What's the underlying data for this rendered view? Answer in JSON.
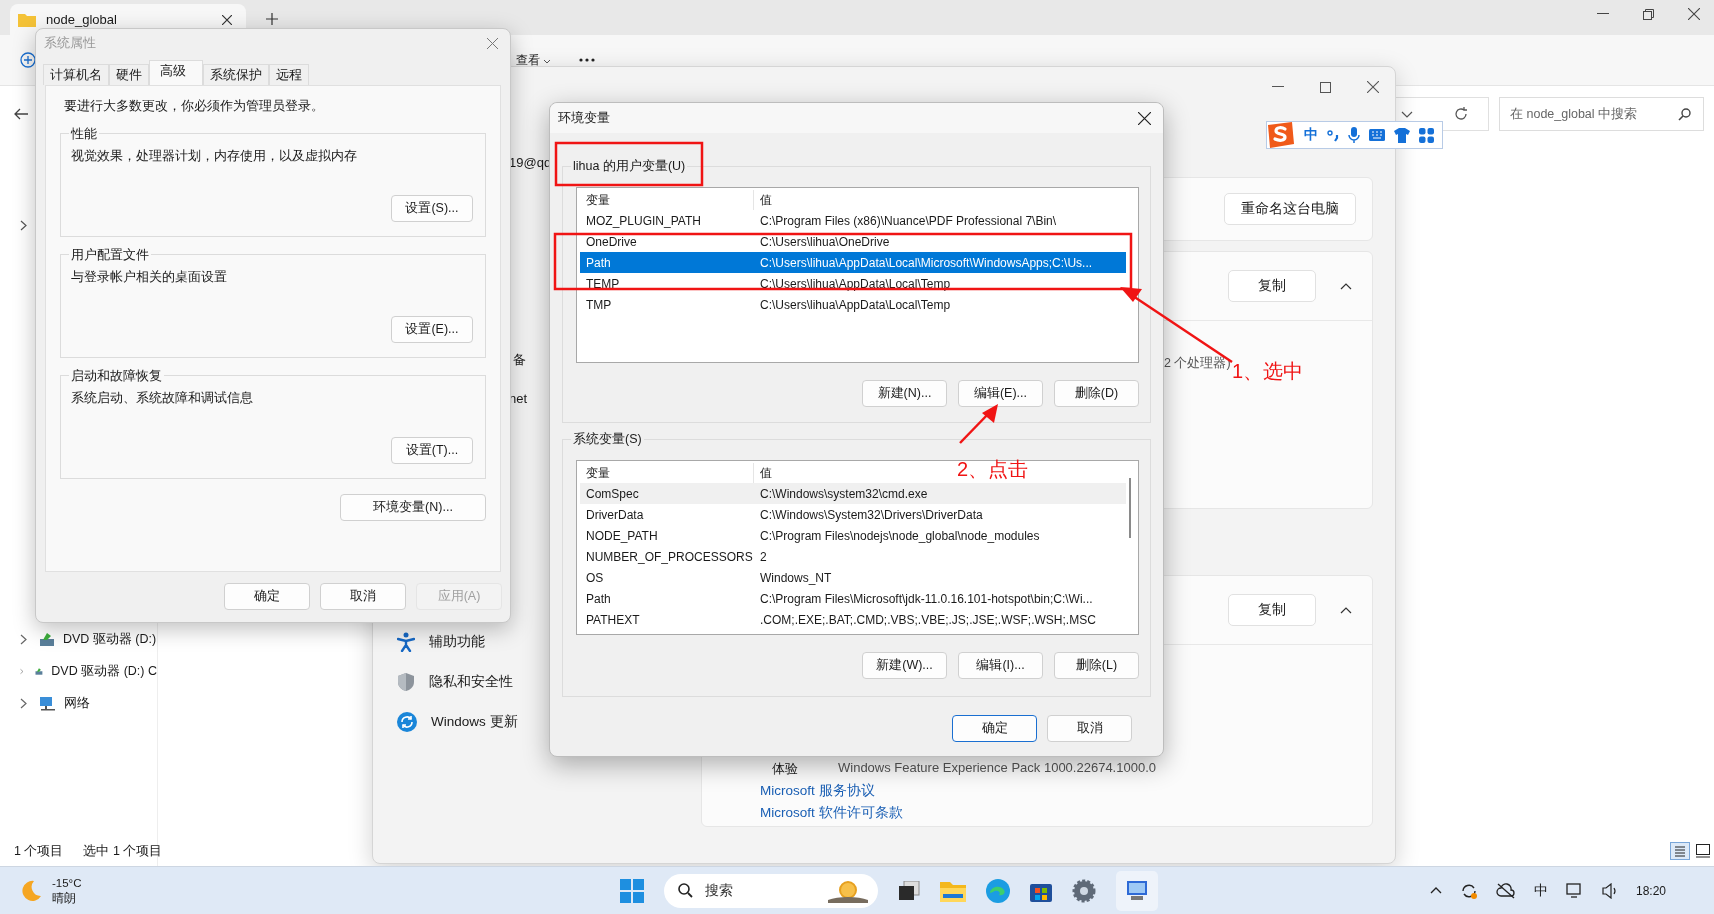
{
  "explorer": {
    "tab_title": "node_global",
    "toolbar_view": "查看",
    "search_placeholder": "在 node_global 中搜索",
    "nav_items": [
      {
        "label": "DVD 驱动器 (D:)"
      },
      {
        "label": "DVD 驱动器 (D:) C"
      },
      {
        "label": "网络"
      }
    ],
    "status": [
      "1 个项目",
      "选中 1 个项目"
    ]
  },
  "ime_bar": {
    "mode": "中"
  },
  "settings": {
    "partial_labels": [
      "19@qq",
      "备",
      "net"
    ],
    "nav_items": [
      {
        "label": "辅助功能",
        "kind": "accessibility"
      },
      {
        "label": "隐私和安全性",
        "kind": "privacy"
      },
      {
        "label": "Windows 更新",
        "kind": "update"
      }
    ],
    "rename_button": "重命名这台电脑",
    "copy_buttons": [
      "复制",
      "复制"
    ],
    "processor_text": "2 个处理器)",
    "feature_label": "体验",
    "feature_value": "Windows Feature Experience Pack 1000.22674.1000.0",
    "links": [
      "Microsoft 服务协议",
      "Microsoft 软件许可条款"
    ]
  },
  "system_properties": {
    "title": "系统属性",
    "tabs": [
      {
        "label": "计算机名",
        "selected": false
      },
      {
        "label": "硬件",
        "selected": false
      },
      {
        "label": "高级",
        "selected": true
      },
      {
        "label": "系统保护",
        "selected": false
      },
      {
        "label": "远程",
        "selected": false
      }
    ],
    "notice": "要进行大多数更改，你必须作为管理员登录。",
    "groups": [
      {
        "legend": "性能",
        "description": "视觉效果，处理器计划，内存使用，以及虚拟内存",
        "button": "设置(S)..."
      },
      {
        "legend": "用户配置文件",
        "description": "与登录帐户相关的桌面设置",
        "button": "设置(E)..."
      },
      {
        "legend": "启动和故障恢复",
        "description": "系统启动、系统故障和调试信息",
        "button": "设置(T)..."
      }
    ],
    "env_button": "环境变量(N)...",
    "buttons": [
      {
        "label": "确定",
        "disabled": false
      },
      {
        "label": "取消",
        "disabled": false
      },
      {
        "label": "应用(A)",
        "disabled": true
      }
    ]
  },
  "env_dialog": {
    "title": "环境变量",
    "sections": [
      {
        "legend": "lihua 的用户变量(U)",
        "focused": true,
        "columns": [
          "变量",
          "值"
        ],
        "rows": [
          {
            "name": "MOZ_PLUGIN_PATH",
            "value": "C:\\Program Files (x86)\\Nuance\\PDF Professional 7\\Bin\\",
            "selected": false
          },
          {
            "name": "OneDrive",
            "value": "C:\\Users\\lihua\\OneDrive",
            "selected": false
          },
          {
            "name": "Path",
            "value": "C:\\Users\\lihua\\AppData\\Local\\Microsoft\\WindowsApps;C:\\Us...",
            "selected": true
          },
          {
            "name": "TEMP",
            "value": "C:\\Users\\lihua\\AppData\\Local\\Temp",
            "selected": false
          },
          {
            "name": "TMP",
            "value": "C:\\Users\\lihua\\AppData\\Local\\Temp",
            "selected": false
          }
        ],
        "buttons": [
          "新建(N)...",
          "编辑(E)...",
          "删除(D)"
        ]
      },
      {
        "legend": "系统变量(S)",
        "focused": false,
        "columns": [
          "变量",
          "值"
        ],
        "rows": [
          {
            "name": "ComSpec",
            "value": "C:\\Windows\\system32\\cmd.exe",
            "selected": true
          },
          {
            "name": "DriverData",
            "value": "C:\\Windows\\System32\\Drivers\\DriverData",
            "selected": false
          },
          {
            "name": "NODE_PATH",
            "value": "C:\\Program Files\\nodejs\\node_global\\node_modules",
            "selected": false
          },
          {
            "name": "NUMBER_OF_PROCESSORS",
            "value": "2",
            "selected": false
          },
          {
            "name": "OS",
            "value": "Windows_NT",
            "selected": false
          },
          {
            "name": "Path",
            "value": "C:\\Program Files\\Microsoft\\jdk-11.0.16.101-hotspot\\bin;C:\\Wi...",
            "selected": false
          },
          {
            "name": "PATHEXT",
            "value": ".COM;.EXE;.BAT;.CMD;.VBS;.VBE;.JS;.JSE;.WSF;.WSH;.MSC",
            "selected": false
          }
        ],
        "buttons": [
          "新建(W)...",
          "编辑(I)...",
          "删除(L)"
        ]
      }
    ],
    "buttons": [
      {
        "label": "确定",
        "default": true
      },
      {
        "label": "取消",
        "default": false
      }
    ]
  },
  "annotations": [
    "1、选中",
    "2、点击"
  ],
  "taskbar": {
    "temperature": "-15°C",
    "condition": "晴朗",
    "search_placeholder": "搜索",
    "ime": "中",
    "time": "18:20"
  }
}
